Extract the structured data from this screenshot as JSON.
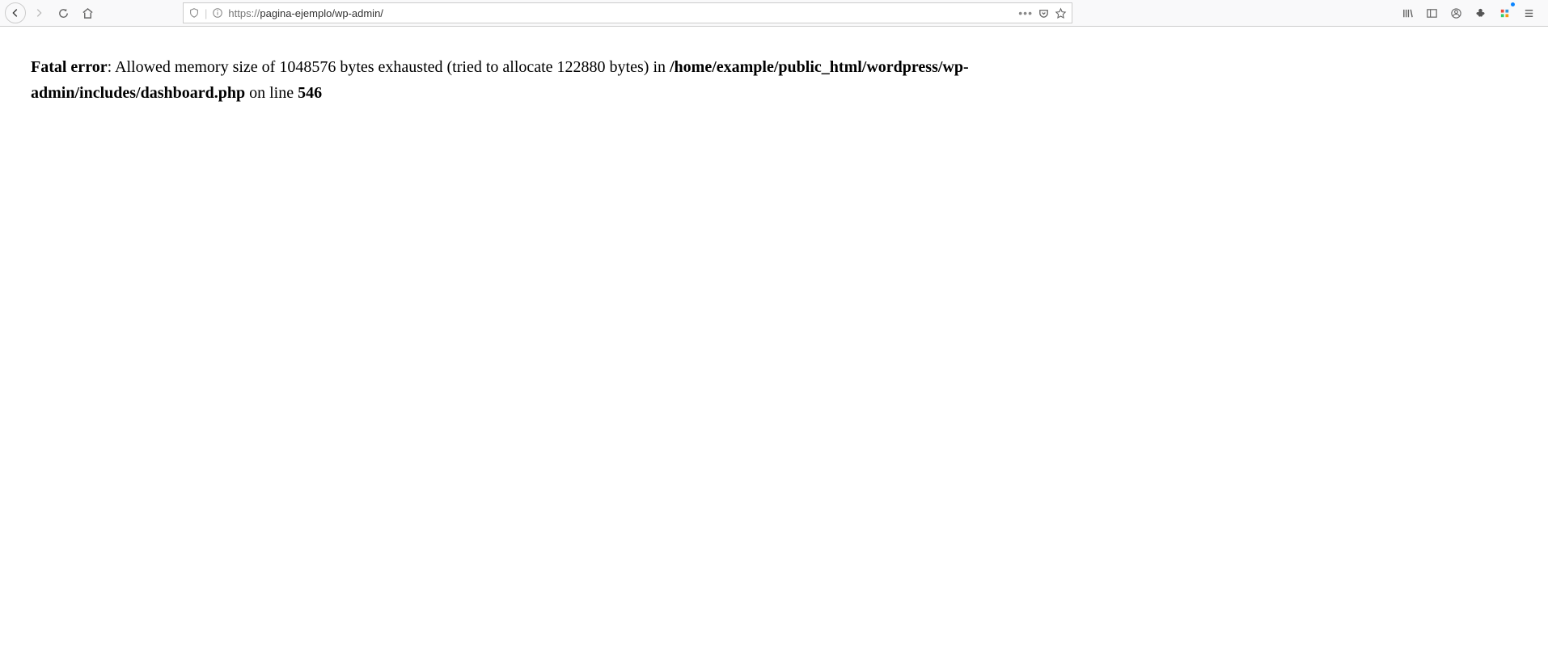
{
  "browser": {
    "url_protocol": "https://",
    "url_domain": "pagina-ejemplo",
    "url_path": "/wp-admin/"
  },
  "error": {
    "label": "Fatal error",
    "message": ": Allowed memory size of 1048576 bytes exhausted (tried to allocate 122880 bytes) in ",
    "path": "/home/example/public_html/wordpress/wp-admin/includes/dashboard.php",
    "on_line_text": " on line ",
    "line_number": "546"
  }
}
